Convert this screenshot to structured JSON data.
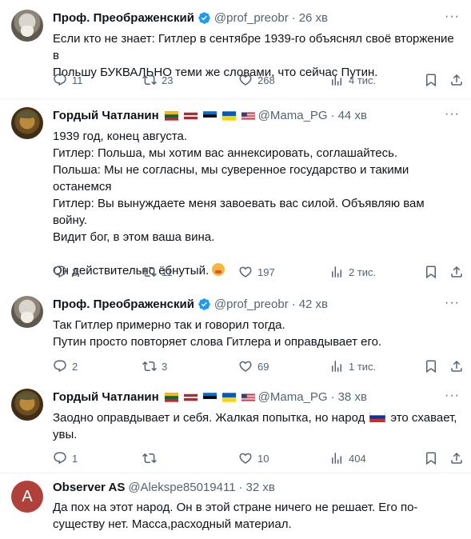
{
  "icon_color": "#536471",
  "verified_color": "#1d9bf0",
  "tweets": [
    {
      "name": "Проф. Преображенский",
      "handle": "@prof_preobr",
      "time": "26 хв",
      "verified": true,
      "flags": [],
      "text": [
        "Если кто не знает: Гитлер в сентябре 1939-го объяснял своё вторжение в",
        "Польшу БУКВАЛЬНО теми же словами, что сейчас Путин."
      ],
      "replies": "11",
      "retweets": "23",
      "likes": "268",
      "views": "4 тис."
    },
    {
      "name": "Гордый Чатланин",
      "handle": "@Mama_PG",
      "time": "44 хв",
      "verified": false,
      "flags": [
        "lithuania",
        "latvia",
        "estonia",
        "ukraine",
        "usa"
      ],
      "text": [
        "1939 год, конец августа.",
        "Гитлер: Польша, мы хотим вас аннексировать, соглашайтесь.",
        "Польша: Мы не согласны, мы суверенное государство и такими",
        "останемся",
        "Гитлер: Вы вынуждаете меня завоевать вас силой. Объявляю вам войну.",
        "Видит бог, в этом ваша вина.",
        "",
        "Он действительно ёбнутый."
      ],
      "replies": "3",
      "retweets": "11",
      "likes": "197",
      "views": "2 тис."
    },
    {
      "name": "Проф. Преображенский",
      "handle": "@prof_preobr",
      "time": "42 хв",
      "verified": true,
      "flags": [],
      "text": [
        "Так Гитлер примерно так и говорил тогда.",
        "Путин просто повторяет слова Гитлера и оправдывает его."
      ],
      "replies": "2",
      "retweets": "3",
      "likes": "69",
      "views": "1 тис."
    },
    {
      "name": "Гордый Чатланин",
      "handle": "@Mama_PG",
      "time": "38 хв",
      "verified": false,
      "flags": [
        "lithuania",
        "latvia",
        "estonia",
        "ukraine",
        "usa"
      ],
      "text_before": "Заодно оправдывает и себя. Жалкая попытка, но народ",
      "text_after": "это схавает,",
      "text_line2": "увы.",
      "replies": "1",
      "retweets": "",
      "likes": "10",
      "views": "404"
    },
    {
      "name": "Observer AS",
      "handle": "@Alekspe85019411",
      "time": "32 хв",
      "avatar_letter": "A",
      "text": [
        "Да пох на этот народ. Он в этой стране ничего не решает. Его по-",
        "существу нет. Масса,расходный материал."
      ]
    }
  ],
  "sep": "·"
}
